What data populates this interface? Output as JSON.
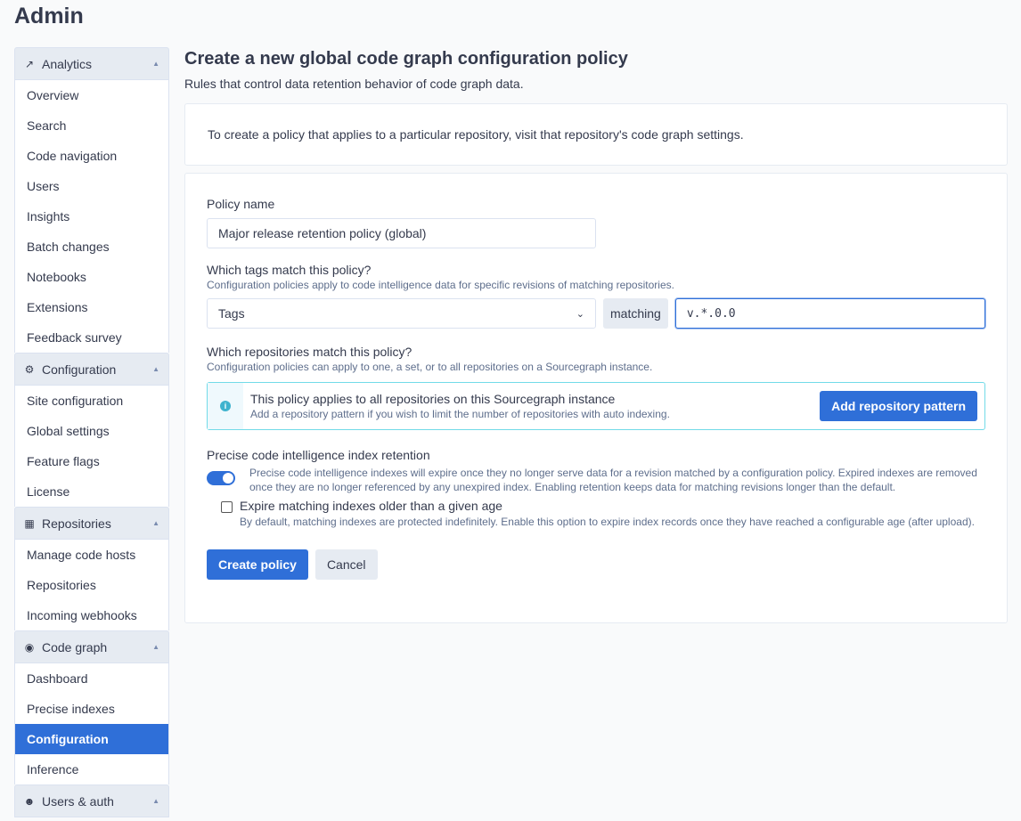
{
  "header": {
    "title": "Admin"
  },
  "sidebar": {
    "sections": [
      {
        "label": "Analytics",
        "icon": "chart-line-icon",
        "items": [
          "Overview",
          "Search",
          "Code navigation",
          "Users",
          "Insights",
          "Batch changes",
          "Notebooks",
          "Extensions",
          "Feedback survey"
        ]
      },
      {
        "label": "Configuration",
        "icon": "cogs-icon",
        "items": [
          "Site configuration",
          "Global settings",
          "Feature flags",
          "License"
        ]
      },
      {
        "label": "Repositories",
        "icon": "repository-icon",
        "items": [
          "Manage code hosts",
          "Repositories",
          "Incoming webhooks"
        ]
      },
      {
        "label": "Code graph",
        "icon": "brain-icon",
        "items": [
          "Dashboard",
          "Precise indexes",
          "Configuration",
          "Inference"
        ],
        "active": "Configuration"
      },
      {
        "label": "Users & auth",
        "icon": "users-icon",
        "items": []
      }
    ]
  },
  "main": {
    "title": "Create a new global code graph configuration policy",
    "subtitle": "Rules that control data retention behavior of code graph data.",
    "note": "To create a policy that applies to a particular repository, visit that repository's code graph settings.",
    "policy_name_label": "Policy name",
    "policy_name_value": "Major release retention policy (global)",
    "tags_label": "Which tags match this policy?",
    "tags_help": "Configuration policies apply to code intelligence data for specific revisions of matching repositories.",
    "type_select": "Tags",
    "matching_label": "matching",
    "pattern_value": "v.*.0.0",
    "repos_label": "Which repositories match this policy?",
    "repos_help": "Configuration policies can apply to one, a set, or to all repositories on a Sourcegraph instance.",
    "alert_title": "This policy applies to all repositories on this Sourcegraph instance",
    "alert_body": "Add a repository pattern if you wish to limit the number of repositories with auto indexing.",
    "add_pattern_button": "Add repository pattern",
    "retention_label": "Precise code intelligence index retention",
    "retention_help": "Precise code intelligence indexes will expire once they no longer serve data for a revision matched by a configuration policy. Expired indexes are removed once they are no longer referenced by any unexpired index. Enabling retention keeps data for matching revisions longer than the default.",
    "retention_enabled": true,
    "expire_label": "Expire matching indexes older than a given age",
    "expire_checked": false,
    "expire_help": "By default, matching indexes are protected indefinitely. Enable this option to expire index records once they have reached a configurable age (after upload).",
    "create_button": "Create policy",
    "cancel_button": "Cancel"
  }
}
